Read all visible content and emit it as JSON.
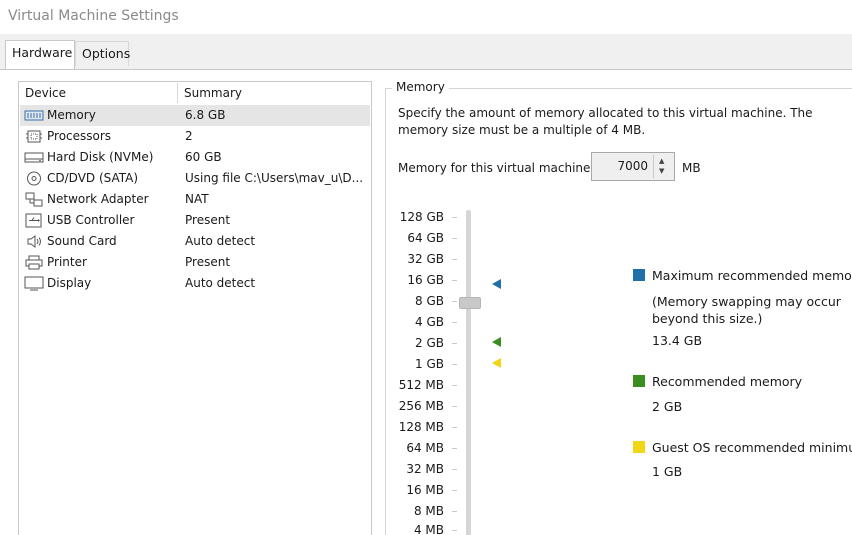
{
  "window": {
    "title": "Virtual Machine Settings"
  },
  "tabs": [
    {
      "label": "Hardware",
      "active": true
    },
    {
      "label": "Options",
      "active": false
    }
  ],
  "devices": {
    "headers": {
      "device": "Device",
      "summary": "Summary"
    },
    "items": [
      {
        "icon": "memory-icon",
        "name": "Memory",
        "summary": "6.8 GB",
        "selected": true
      },
      {
        "icon": "processor-icon",
        "name": "Processors",
        "summary": "2"
      },
      {
        "icon": "hard-disk-icon",
        "name": "Hard Disk (NVMe)",
        "summary": "60 GB"
      },
      {
        "icon": "cd-dvd-icon",
        "name": "CD/DVD (SATA)",
        "summary": "Using file C:\\Users\\mav_u\\D..."
      },
      {
        "icon": "network-adapter-icon",
        "name": "Network Adapter",
        "summary": "NAT"
      },
      {
        "icon": "usb-controller-icon",
        "name": "USB Controller",
        "summary": "Present"
      },
      {
        "icon": "sound-card-icon",
        "name": "Sound Card",
        "summary": "Auto detect"
      },
      {
        "icon": "printer-icon",
        "name": "Printer",
        "summary": "Present"
      },
      {
        "icon": "display-icon",
        "name": "Display",
        "summary": "Auto detect"
      }
    ]
  },
  "memory": {
    "group_title": "Memory",
    "description": "Specify the amount of memory allocated to this virtual machine. The memory size must be a multiple of 4 MB.",
    "field_label": "Memory for this virtual machine:",
    "value": "7000",
    "unit": "MB",
    "scale_labels": [
      "128 GB",
      "64 GB",
      "32 GB",
      "16 GB",
      "8 GB",
      "4 GB",
      "2 GB",
      "1 GB",
      "512 MB",
      "256 MB",
      "128 MB",
      "64 MB",
      "32 MB",
      "16 MB",
      "8 MB",
      "4 MB"
    ],
    "legend": {
      "max_title": "Maximum recommended memory",
      "max_note": "(Memory swapping may occur beyond this size.)",
      "max_value": "13.4 GB",
      "rec_title": "Recommended memory",
      "rec_value": "2 GB",
      "min_title": "Guest OS recommended minimum",
      "min_value": "1 GB"
    },
    "colors": {
      "max": "#1f6fa8",
      "recommended": "#3c8d1f",
      "minimum": "#f2d515"
    }
  }
}
